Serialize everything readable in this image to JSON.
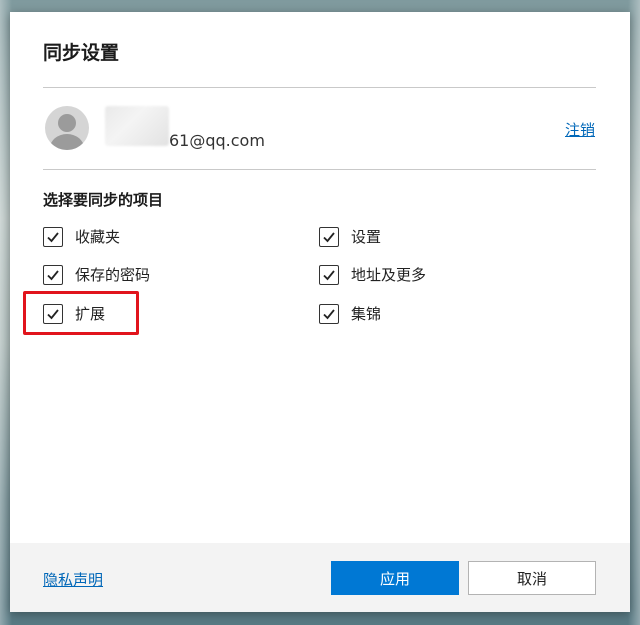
{
  "dialog": {
    "title": "同步设置",
    "account": {
      "email_suffix": "61@qq.com",
      "signout_label": "注销"
    },
    "section_title": "选择要同步的项目",
    "options": [
      {
        "label": "收藏夹",
        "checked": true
      },
      {
        "label": "设置",
        "checked": true
      },
      {
        "label": "保存的密码",
        "checked": true
      },
      {
        "label": "地址及更多",
        "checked": true
      },
      {
        "label": "扩展",
        "checked": true
      },
      {
        "label": "集锦",
        "checked": true
      }
    ],
    "footer": {
      "privacy_label": "隐私声明",
      "apply_label": "应用",
      "cancel_label": "取消"
    }
  },
  "colors": {
    "accent": "#0078d4",
    "link": "#0067b8",
    "highlight": "#e1141c"
  }
}
